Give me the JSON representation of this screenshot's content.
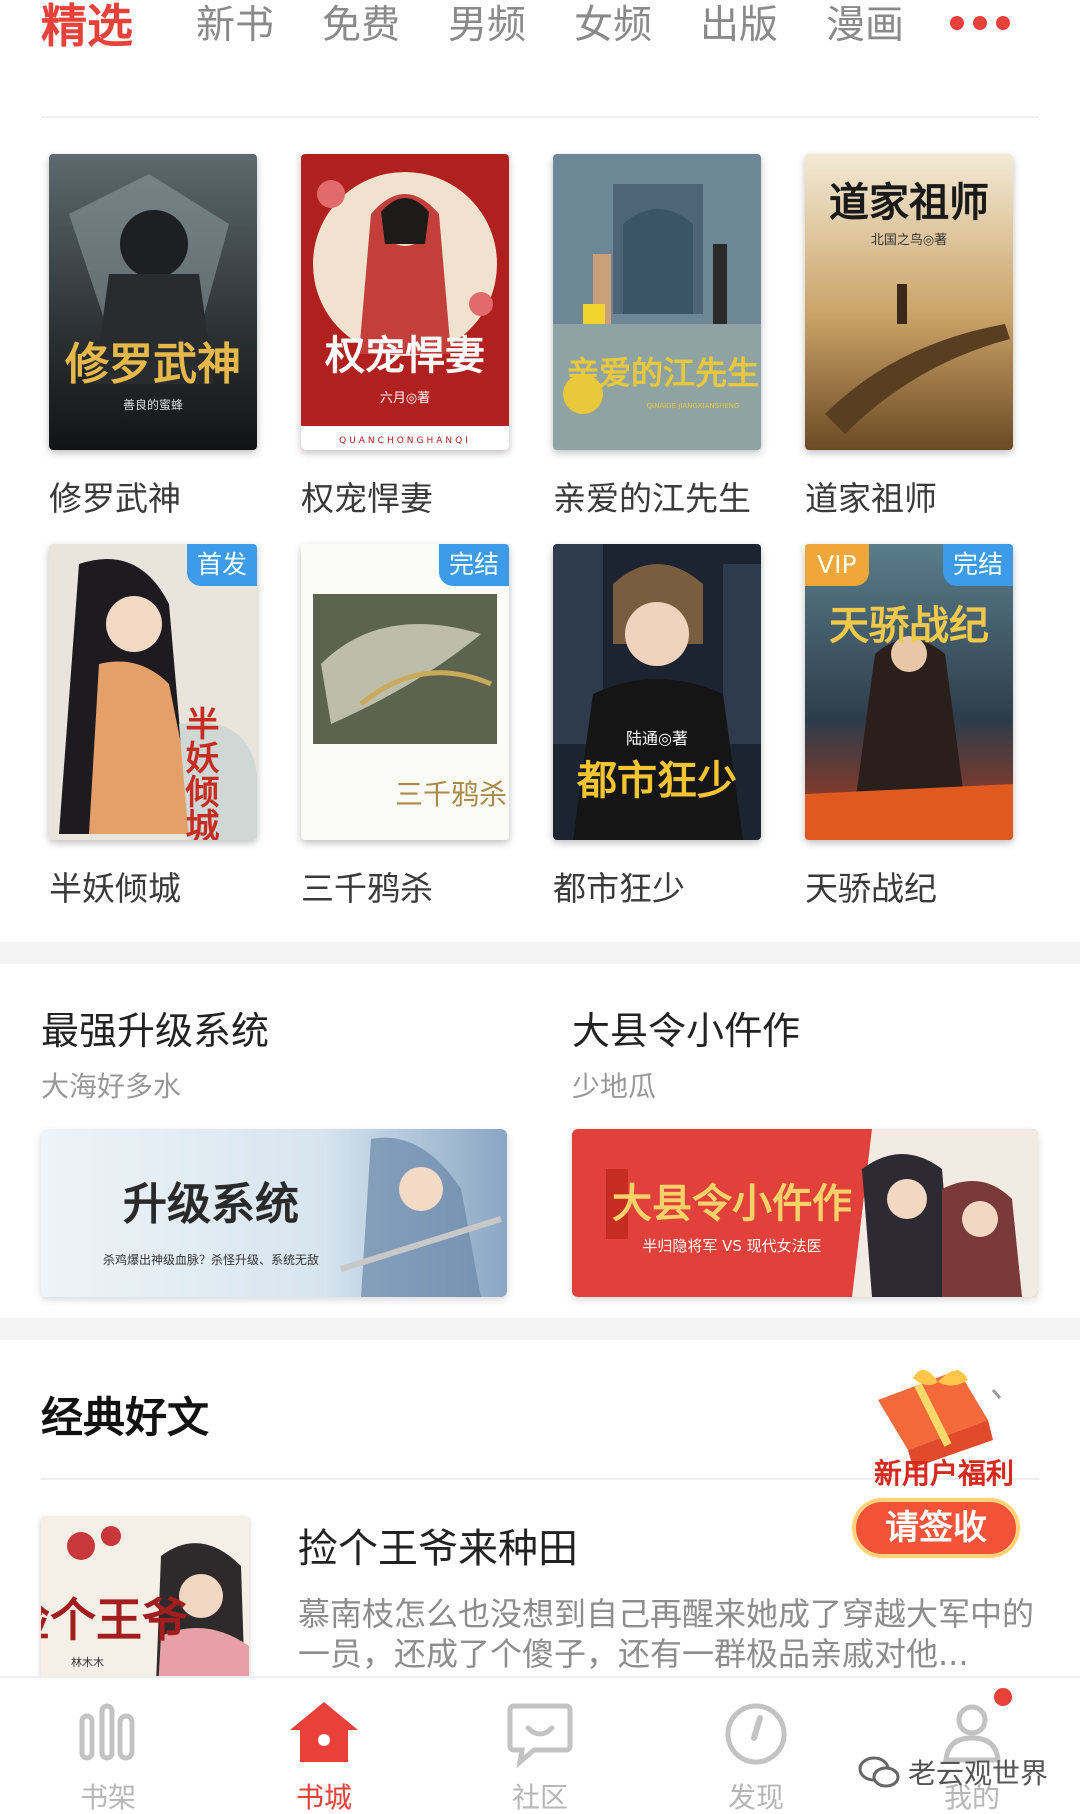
{
  "tabs": [
    {
      "label": "精选",
      "active": true
    },
    {
      "label": "新书"
    },
    {
      "label": "免费"
    },
    {
      "label": "男频"
    },
    {
      "label": "女频"
    },
    {
      "label": "出版"
    },
    {
      "label": "漫画"
    }
  ],
  "colors": {
    "accent": "#e8413a",
    "badge_blue": "#3d9bea",
    "badge_vip": "#f0a73a"
  },
  "books": [
    {
      "title": "修罗武神",
      "cover_text": "修罗武神",
      "cover_author": "善良的蜜蜂"
    },
    {
      "title": "权宠悍妻",
      "cover_text": "权宠悍妻",
      "cover_author": "六月◎著",
      "cover_sub": "QUANCHONGHANQI"
    },
    {
      "title": "亲爱的江先生",
      "cover_text": "亲爱的江先生",
      "cover_sub": "QINAIDE JIANGXIANSHENG"
    },
    {
      "title": "道家祖师",
      "cover_text": "道家祖师",
      "cover_author": "北国之鸟◎著"
    },
    {
      "title": "半妖倾城",
      "cover_text": "半妖倾城",
      "badge": "首发"
    },
    {
      "title": "三千鸦杀",
      "cover_text": "三千鸦杀",
      "badge": "完结"
    },
    {
      "title": "都市狂少",
      "cover_text": "都市狂少",
      "cover_author": "陆通◎著"
    },
    {
      "title": "天骄战纪",
      "cover_text": "天骄战纪",
      "badge": "完结",
      "vip": "VIP"
    }
  ],
  "banners": [
    {
      "title": "最强升级系统",
      "author": "大海好多水",
      "art_title": "升级系统",
      "art_sub": "杀鸡爆出神级血脉？杀怪升级、系统无敌"
    },
    {
      "title": "大县令小仵作",
      "author": "少地瓜",
      "art_title": "大县令小仵作",
      "art_sub": "半归隐将军 VS 现代女法医"
    }
  ],
  "classics": {
    "heading": "经典好文",
    "item": {
      "title": "捡个王爷来种田",
      "desc": "慕南枝怎么也没想到自己再醒来她成了穿越大军中的一员，还成了个傻子，还有一群极品亲戚对他...",
      "cover_text": "捡个王爷",
      "cover_author": "林木木"
    }
  },
  "promo": {
    "line1": "新用户福利",
    "button": "请签收"
  },
  "bottom_nav": [
    {
      "label": "书架",
      "icon": "bookshelf-icon"
    },
    {
      "label": "书城",
      "icon": "home-icon",
      "active": true
    },
    {
      "label": "社区",
      "icon": "chat-icon"
    },
    {
      "label": "发现",
      "icon": "compass-icon"
    },
    {
      "label": "我的",
      "icon": "user-icon"
    }
  ],
  "watermark": "老云观世界"
}
